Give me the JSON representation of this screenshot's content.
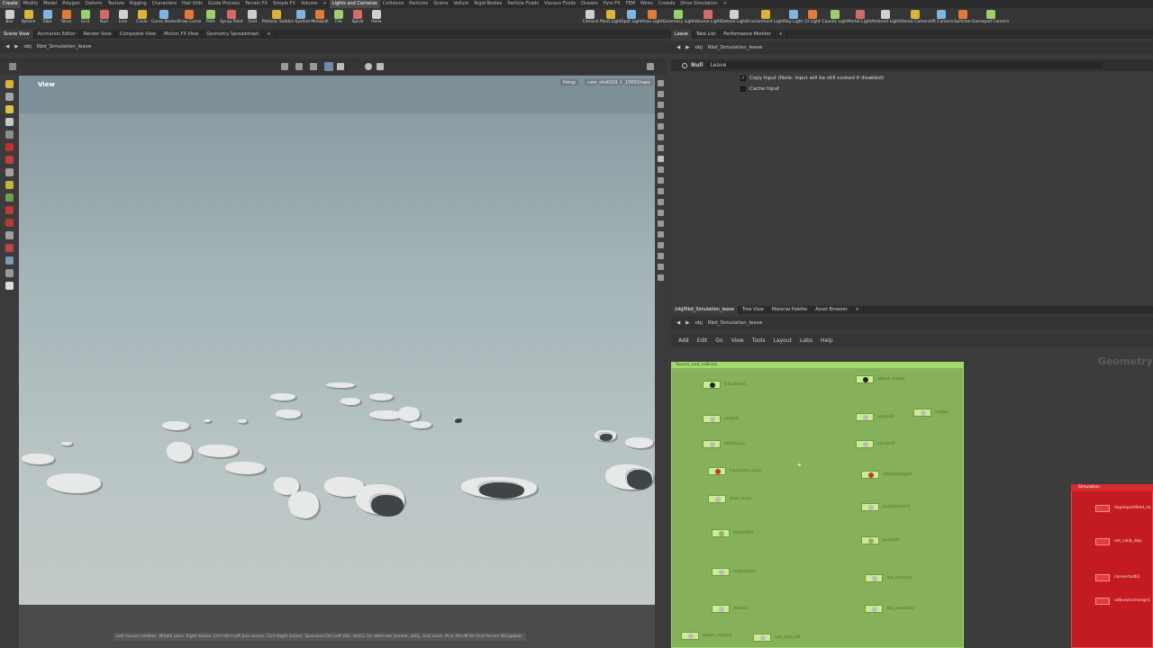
{
  "shelf": {
    "tabs": [
      "Create",
      "Modify",
      "Model",
      "Polygon",
      "Deform",
      "Texture",
      "Rigging",
      "Characters",
      "Hair Utils",
      "Guide Process",
      "Terrain FX",
      "Simple FX",
      "Volume",
      "+",
      "Lights and Cameras",
      "Collisions",
      "Particles",
      "Grains",
      "Vellum",
      "Rigid Bodies",
      "Particle Fluids",
      "Viscous Fluids",
      "Oceans",
      "Pyro FX",
      "FEM",
      "Wires",
      "Crowds",
      "Drive Simulation",
      "+"
    ],
    "active_tabs": [
      "Create",
      "Lights and Cameras"
    ],
    "left_tools": [
      "Box",
      "Sphere",
      "Tube",
      "Torus",
      "Grid",
      "Null",
      "Line",
      "Circle",
      "Curve Bezier",
      "Draw Curve",
      "Path",
      "Spray Paint",
      "Font",
      "Platonic Solids",
      "L-System",
      "Metaball",
      "File",
      "Spiral",
      "Helix"
    ],
    "right_tools": [
      "Camera",
      "Point Light",
      "Spot Light",
      "Area Light",
      "Geometry Light",
      "Volume Light",
      "Distant Light",
      "Environment Light",
      "Sky Light",
      "GI Light",
      "Caustic Light",
      "Portal Light",
      "Ambient Light",
      "Stereo Camera",
      "VR Camera",
      "Switcher",
      "Gamepad Camera"
    ]
  },
  "viewport": {
    "desk_tabs": [
      "Scene View",
      "Animation Editor",
      "Render View",
      "Composite View",
      "Motion FX View",
      "Geometry Spreadsheet",
      "+"
    ],
    "path_obj": "obj",
    "path_node": "Rbd_Simulation_leave",
    "view_label": "View",
    "persp": "Persp",
    "camera": "cam_shot029_1_1565Shape",
    "hint": "Left mouse tumbles. Middle pans. Right dollies. Ctrl+Alt+Left box-zooms. Ctrl+Right zooms. Spacebar-Ctrl-Left tilts. Hold L for alternate tumble, dolly, and zoom. M or Alt+M for First Person Navigation."
  },
  "params": {
    "tabs": [
      "Leave",
      "Take List",
      "Performance Monitor",
      "+"
    ],
    "path_obj": "obj",
    "path_node": "Rbd_Simulation_leave",
    "node_type": "Null",
    "node_name": "Leave",
    "copy_input": "Copy Input (Note: Input will be still cooked if disabled)",
    "cache_input": "Cache Input"
  },
  "network": {
    "tabs": [
      "/obj/Rbd_Simulation_leave",
      "Tree View",
      "Material Palette",
      "Asset Browser",
      "+"
    ],
    "path_obj": "obj",
    "path_node": "Rbd_Simulation_leave",
    "menu": [
      "Add",
      "Edit",
      "Go",
      "View",
      "Tools",
      "Layout",
      "Labs",
      "Help"
    ],
    "context_label": "Geometry",
    "green_box_title": "Source_and_collision",
    "red_box_title": "Simulation",
    "red_nodes": [
      "dopimportfield_se",
      "vel_calib_dop",
      "convertvdb1",
      "vdbvectormerge1"
    ],
    "green_nodes_left": [
      "transform1",
      "unpack",
      "attribvop1",
      "transform_copy",
      "blast_main",
      "timeshift1",
      "matchsize1",
      "delete1",
      "swsas_studio1"
    ],
    "green_nodes_right": [
      "object_merge",
      "unpack1",
      "convert1",
      "attribwrangle1",
      "pointdeform1",
      "packed1",
      "rbd_material",
      "rbd_assemble",
      "box_test_sdf",
      "scatter"
    ]
  },
  "colors": {
    "viewport_top": "#7a8c92",
    "viewport_bottom": "#c2cac8",
    "network_box_green": "#86b15a",
    "network_box_red": "#c41a22",
    "node_green": "#c9ec96"
  }
}
